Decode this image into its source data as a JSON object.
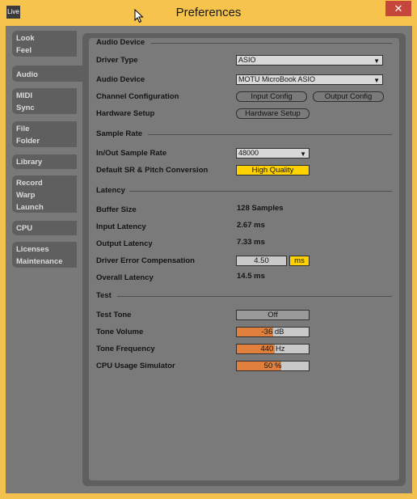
{
  "window": {
    "title": "Preferences",
    "app_icon_text": "Live",
    "close_label": "✕"
  },
  "sidebar": {
    "groups": [
      {
        "items": [
          "Look",
          "Feel"
        ],
        "active": false
      },
      {
        "items": [
          "Audio"
        ],
        "active": true
      },
      {
        "items": [
          "MIDI",
          "Sync"
        ],
        "active": false
      },
      {
        "items": [
          "File",
          "Folder"
        ],
        "active": false
      },
      {
        "items": [
          "Library"
        ],
        "active": false
      },
      {
        "items": [
          "Record",
          "Warp",
          "Launch"
        ],
        "active": false
      },
      {
        "items": [
          "CPU"
        ],
        "active": false
      },
      {
        "items": [
          "Licenses",
          "Maintenance"
        ],
        "active": false
      }
    ]
  },
  "audio_device": {
    "section_title": "Audio Device",
    "driver_type_label": "Driver Type",
    "driver_type_value": "ASIO",
    "audio_device_label": "Audio Device",
    "audio_device_value": "MOTU MicroBook ASIO",
    "channel_config_label": "Channel Configuration",
    "input_config_button": "Input Config",
    "output_config_button": "Output Config",
    "hardware_setup_label": "Hardware Setup",
    "hardware_setup_button": "Hardware Setup"
  },
  "sample_rate": {
    "section_title": "Sample Rate",
    "in_out_label": "In/Out Sample Rate",
    "in_out_value": "48000",
    "default_sr_label": "Default SR & Pitch Conversion",
    "default_sr_value": "High Quality"
  },
  "latency": {
    "section_title": "Latency",
    "buffer_size_label": "Buffer Size",
    "buffer_size_value": "128 Samples",
    "input_latency_label": "Input Latency",
    "input_latency_value": "2.67 ms",
    "output_latency_label": "Output Latency",
    "output_latency_value": "7.33 ms",
    "driver_error_label": "Driver Error Compensation",
    "driver_error_value": "4.50",
    "driver_error_unit": "ms",
    "overall_label": "Overall Latency",
    "overall_value": "14.5 ms"
  },
  "test": {
    "section_title": "Test",
    "test_tone_label": "Test Tone",
    "test_tone_value": "Off",
    "tone_volume_label": "Tone Volume",
    "tone_volume_value": "-36",
    "tone_volume_unit": "dB",
    "tone_volume_fraction": 0.5,
    "tone_frequency_label": "Tone Frequency",
    "tone_frequency_value": "440",
    "tone_frequency_unit": "Hz",
    "tone_frequency_fraction": 0.53,
    "cpu_sim_label": "CPU Usage Simulator",
    "cpu_sim_value": "50 %",
    "cpu_sim_fraction": 0.62
  },
  "colors": {
    "accent_orange": "#e0803c",
    "highlight_yellow": "#ffd200",
    "title_bar": "#f6c34c"
  }
}
